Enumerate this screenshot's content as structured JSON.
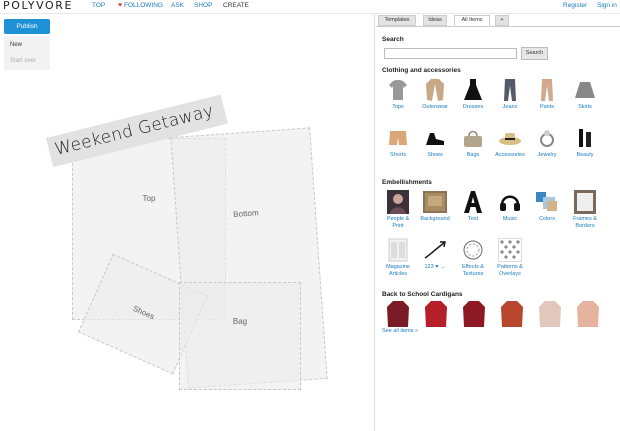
{
  "nav": {
    "logo": "POLYVORE",
    "links": [
      "TOP",
      "FOLLOWING",
      "ASK",
      "SHOP",
      "CREATE"
    ],
    "register": "Register",
    "signin": "Sign in"
  },
  "editor": {
    "publish": "Publish",
    "new": "New",
    "start_over": "Start over",
    "title": "Weekend Getaway",
    "boxes": [
      "Top",
      "Bottom",
      "Shoes",
      "Bag"
    ]
  },
  "panel": {
    "tabs": [
      "Templates",
      "Ideas",
      "All Items",
      "+"
    ],
    "active_tab": "All Items",
    "search_title": "Search",
    "search_placeholder": "",
    "search_button": "Search",
    "clothing_title": "Clothing and accessories",
    "clothing": [
      "Tops",
      "Outerwear",
      "Dresses",
      "Jeans",
      "Pants",
      "Skirts",
      "Shorts",
      "Shoes",
      "Bags",
      "Accessories",
      "Jewelry",
      "Beauty"
    ],
    "embellish_title": "Embellishments",
    "embellish": [
      "People & Print",
      "Background",
      "Text",
      "Music",
      "Colors",
      "Frames & Borders",
      "Magazine Articles",
      "123 ♥ →",
      "Effects & Textures",
      "Patterns & Overlays"
    ],
    "cardigans_title": "Back to School Cardigans",
    "see_all": "See all items »"
  },
  "colors": {
    "accent": "#1e90d6",
    "link": "#1a7bbf",
    "heart": "#e23a3a"
  }
}
